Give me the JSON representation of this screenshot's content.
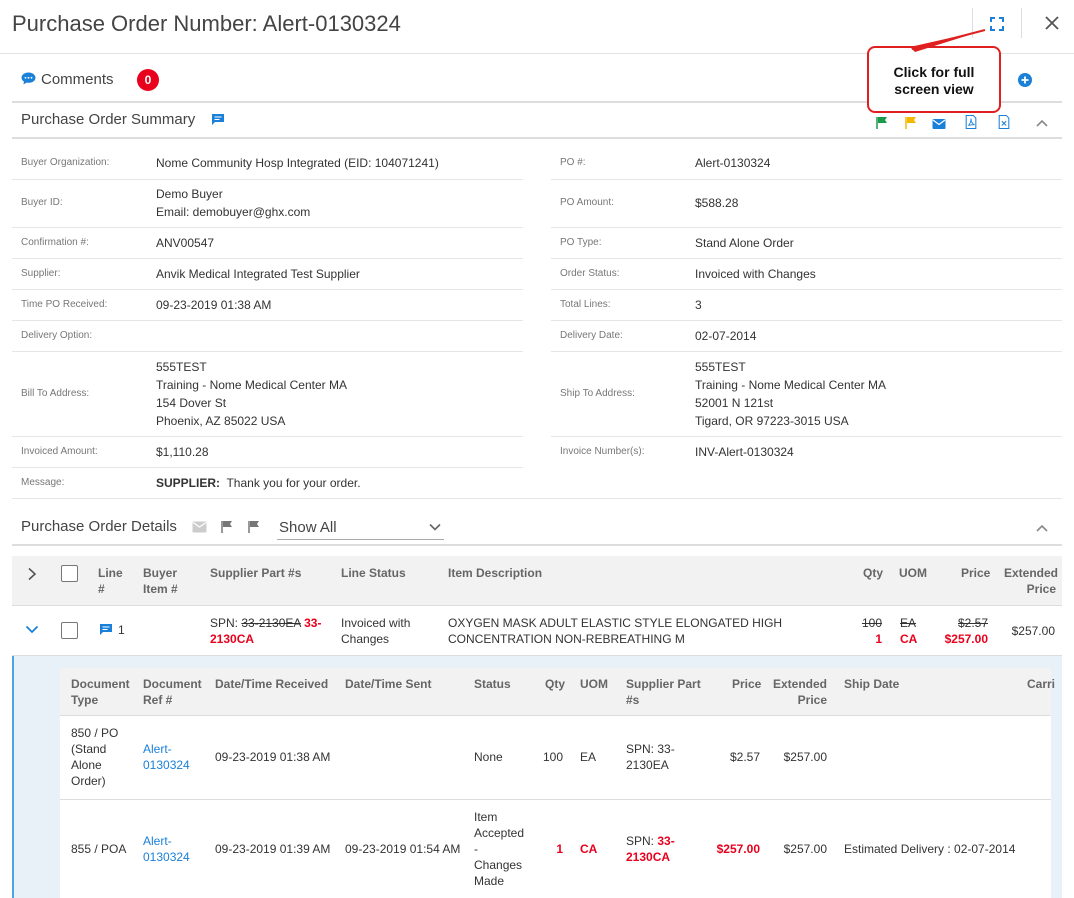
{
  "header": {
    "title": "Purchase Order Number: Alert-0130324"
  },
  "callout": {
    "line1": "Click for full",
    "line2": "screen view"
  },
  "comments": {
    "label": "Comments",
    "count": "0"
  },
  "summary": {
    "title": "Purchase Order Summary",
    "left": [
      {
        "label": "Buyer Organization:",
        "value": "Nome Community Hosp Integrated (EID: 104071241)"
      },
      {
        "label": "Buyer ID:",
        "value": "Demo Buyer\nEmail: demobuyer@ghx.com"
      },
      {
        "label": "Confirmation #:",
        "value": "ANV00547"
      },
      {
        "label": "Supplier:",
        "value": "Anvik Medical Integrated Test Supplier"
      },
      {
        "label": "Time PO Received:",
        "value": "09-23-2019 01:38 AM"
      },
      {
        "label": "Delivery Option:",
        "value": ""
      },
      {
        "label": "Bill To Address:",
        "value": "555TEST\nTraining - Nome Medical Center MA\n154 Dover St\nPhoenix, AZ 85022 USA"
      },
      {
        "label": "Invoiced Amount:",
        "value": "$1,110.28"
      },
      {
        "label": "Message:",
        "value": "Thank you for your order."
      }
    ],
    "message_prefix": "SUPPLIER:",
    "right": [
      {
        "label": "PO #:",
        "value": "Alert-0130324"
      },
      {
        "label": "PO Amount:",
        "value": "$588.28"
      },
      {
        "label": "PO Type:",
        "value": "Stand Alone Order"
      },
      {
        "label": "Order Status:",
        "value": "Invoiced with Changes"
      },
      {
        "label": "Total Lines:",
        "value": "3"
      },
      {
        "label": "Delivery Date:",
        "value": "02-07-2014"
      },
      {
        "label": "Ship To Address:",
        "value": "555TEST\nTraining - Nome Medical Center MA\n52001 N 121st\nTigard, OR 97223-3015 USA"
      },
      {
        "label": "Invoice Number(s):",
        "value": "INV-Alert-0130324"
      }
    ]
  },
  "details": {
    "title": "Purchase Order Details",
    "filter": "Show All",
    "columns": {
      "line": "Line\n#",
      "buyer_item": "Buyer\nItem #",
      "supplier_part": "Supplier Part #s",
      "line_status": "Line Status",
      "item_desc": "Item Description",
      "qty": "Qty",
      "uom": "UOM",
      "price": "Price",
      "extended": "Extended\nPrice"
    },
    "line": {
      "num": "1",
      "spn_prefix": "SPN:",
      "spn_old": "33-2130EA",
      "spn_new": "33-\n2130CA",
      "status": "Invoiced with\nChanges",
      "description": "OXYGEN MASK  ADULT  ELASTIC STYLE ELONGATED HIGH\nCONCENTRATION NON-REBREATHING M",
      "qty_old": "100",
      "qty_new": "1",
      "uom_old": "EA",
      "uom_new": "CA",
      "price_old": "$2.57",
      "price_new": "$257.00",
      "extended": "$257.00"
    },
    "sub_columns": {
      "doc_type": "Document\nType",
      "doc_ref": "Document\nRef #",
      "received": "Date/Time Received",
      "sent": "Date/Time Sent",
      "status": "Status",
      "qty": "Qty",
      "uom": "UOM",
      "supplier_part": "Supplier Part\n#s",
      "price": "Price",
      "extended": "Extended\nPrice",
      "ship_date": "Ship Date",
      "carrier": "Carri"
    },
    "sub_rows": [
      {
        "doc_type": "850 / PO\n(Stand\nAlone\nOrder)",
        "doc_ref": "Alert-\n0130324",
        "received": "09-23-2019 01:38 AM",
        "sent": "",
        "status": "None",
        "qty": "100",
        "uom": "EA",
        "spn_prefix": "SPN:",
        "spn": "33-\n2130EA",
        "price": "$2.57",
        "extended": "$257.00",
        "ship_date": ""
      },
      {
        "doc_type": "855 / POA",
        "doc_ref": "Alert-\n0130324",
        "received": "09-23-2019 01:39 AM",
        "sent": "09-23-2019 01:54 AM",
        "status": "Item\nAccepted\n-\nChanges\nMade",
        "qty": "1",
        "uom": "CA",
        "spn_prefix": "SPN:",
        "spn": "33-\n2130CA",
        "price": "$257.00",
        "extended": "$257.00",
        "ship_date": "Estimated Delivery : 02-07-2014"
      }
    ]
  },
  "colors": {
    "accent": "#1b80d8",
    "alert": "#e8001c",
    "flag_green": "#1a9b4a",
    "flag_yellow": "#f5b800"
  }
}
